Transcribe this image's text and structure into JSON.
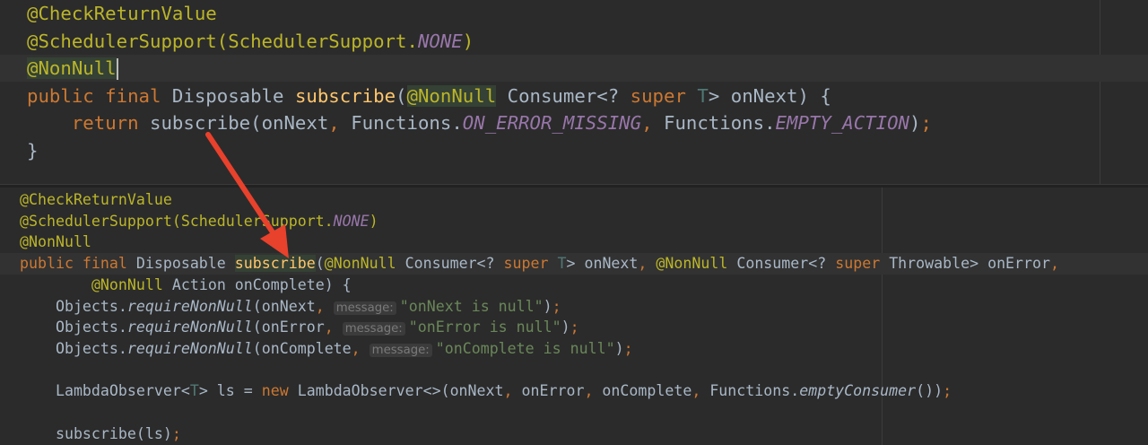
{
  "top_editor": {
    "lines": [
      [
        [
          "a",
          "@CheckReturnValue"
        ]
      ],
      [
        [
          "a",
          "@SchedulerSupport(SchedulerSupport."
        ],
        [
          "s",
          "NONE"
        ],
        [
          "a",
          ")"
        ]
      ],
      [
        [
          "a hl",
          "@NonNull"
        ],
        [
          "caret",
          ""
        ]
      ],
      [
        [
          "k",
          "public final "
        ],
        [
          "t",
          "Disposable "
        ],
        [
          "m",
          "subscribe"
        ],
        [
          "t",
          "("
        ],
        [
          "a hl",
          "@NonNull"
        ],
        [
          "t",
          " Consumer<? "
        ],
        [
          "k",
          "super "
        ],
        [
          "g",
          "T"
        ],
        [
          "t",
          "> onNext) {"
        ]
      ],
      [
        [
          "t",
          "    "
        ],
        [
          "k",
          "return "
        ],
        [
          "t",
          "subscribe(onNext"
        ],
        [
          "k",
          ", "
        ],
        [
          "t",
          "Functions."
        ],
        [
          "s",
          "ON_ERROR_MISSING"
        ],
        [
          "k",
          ", "
        ],
        [
          "t",
          "Functions."
        ],
        [
          "s",
          "EMPTY_ACTION"
        ],
        [
          "t",
          ")"
        ],
        [
          "k",
          ";"
        ]
      ],
      [
        [
          "t",
          "}"
        ]
      ]
    ]
  },
  "bottom_editor": {
    "lines": [
      [
        [
          "a",
          "@CheckReturnValue"
        ]
      ],
      [
        [
          "a",
          "@SchedulerSupport(SchedulerSupport."
        ],
        [
          "s",
          "NONE"
        ],
        [
          "a",
          ")"
        ]
      ],
      [
        [
          "a",
          "@NonNull"
        ]
      ],
      [
        [
          "k",
          "public final "
        ],
        [
          "t",
          "Disposable "
        ],
        [
          "m hl",
          "subscribe"
        ],
        [
          "t",
          "("
        ],
        [
          "a",
          "@NonNull"
        ],
        [
          "t",
          " Consumer<? "
        ],
        [
          "k",
          "super "
        ],
        [
          "g",
          "T"
        ],
        [
          "t",
          "> onNext"
        ],
        [
          "k",
          ", "
        ],
        [
          "a",
          "@NonNull"
        ],
        [
          "t",
          " Consumer<? "
        ],
        [
          "k",
          "super "
        ],
        [
          "t",
          "Throwable> onError"
        ],
        [
          "k",
          ","
        ]
      ],
      [
        [
          "t",
          "        "
        ],
        [
          "a",
          "@NonNull"
        ],
        [
          "t",
          " Action onComplete) {"
        ]
      ],
      [
        [
          "t",
          "    Objects."
        ],
        [
          "i",
          "requireNonNull"
        ],
        [
          "t",
          "(onNext"
        ],
        [
          "k",
          ", "
        ],
        [
          "h",
          "message:"
        ],
        [
          "str",
          "\"onNext is null\""
        ],
        [
          "t",
          ")"
        ],
        [
          "k",
          ";"
        ]
      ],
      [
        [
          "t",
          "    Objects."
        ],
        [
          "i",
          "requireNonNull"
        ],
        [
          "t",
          "(onError"
        ],
        [
          "k",
          ", "
        ],
        [
          "h",
          "message:"
        ],
        [
          "str",
          "\"onError is null\""
        ],
        [
          "t",
          ")"
        ],
        [
          "k",
          ";"
        ]
      ],
      [
        [
          "t",
          "    Objects."
        ],
        [
          "i",
          "requireNonNull"
        ],
        [
          "t",
          "(onComplete"
        ],
        [
          "k",
          ", "
        ],
        [
          "h",
          "message:"
        ],
        [
          "str",
          "\"onComplete is null\""
        ],
        [
          "t",
          ")"
        ],
        [
          "k",
          ";"
        ]
      ],
      [],
      [
        [
          "t",
          "    LambdaObserver<"
        ],
        [
          "g",
          "T"
        ],
        [
          "t",
          "> ls = "
        ],
        [
          "k",
          "new "
        ],
        [
          "t",
          "LambdaObserver<>(onNext"
        ],
        [
          "k",
          ", "
        ],
        [
          "t",
          "onError"
        ],
        [
          "k",
          ", "
        ],
        [
          "t",
          "onComplete"
        ],
        [
          "k",
          ", "
        ],
        [
          "t",
          "Functions."
        ],
        [
          "i",
          "emptyConsumer"
        ],
        [
          "t",
          "())"
        ],
        [
          "k",
          ";"
        ]
      ],
      [],
      [
        [
          "t",
          "    subscribe(ls)"
        ],
        [
          "k",
          ";"
        ]
      ]
    ]
  },
  "colors": {
    "background": "#2b2b2b",
    "annotation": "#bbb529",
    "keyword": "#cc7832",
    "arrow": "#e8412c"
  }
}
